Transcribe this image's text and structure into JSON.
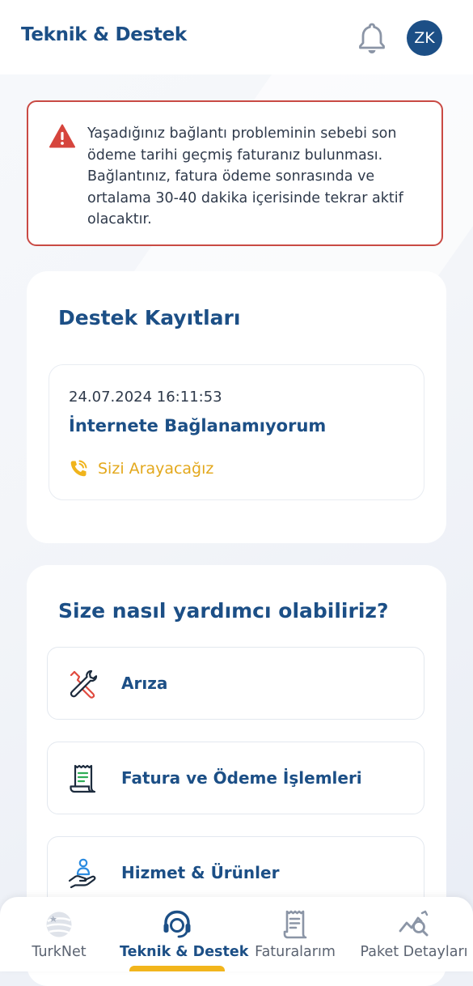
{
  "header": {
    "title": "Teknik & Destek",
    "avatar_initials": "ZK"
  },
  "alert": {
    "message": "Yaşadığınız bağlantı probleminin sebebi son ödeme tarihi geçmiş faturanız bulunması. Bağlantınız, fatura ödeme sonrasında ve ortalama 30-40 dakika içerisinde tekrar aktif olacaktır."
  },
  "records": {
    "title": "Destek Kayıtları",
    "items": [
      {
        "date": "24.07.2024 16:11:53",
        "subject": "İnternete Bağlanamıyorum",
        "status": "Sizi Arayacağız"
      }
    ]
  },
  "help": {
    "title": "Size nasıl yardımcı olabiliriz?",
    "items": [
      {
        "label": "Arıza",
        "icon": "tools-icon"
      },
      {
        "label": "Fatura ve Ödeme İşlemleri",
        "icon": "receipt-icon"
      },
      {
        "label": "Hizmet & Ürünler",
        "icon": "hand-person-icon"
      }
    ]
  },
  "tabbar": {
    "tabs": [
      {
        "label": "TurkNet",
        "icon": "turknet-logo-icon",
        "active": false
      },
      {
        "label": "Teknik & Destek",
        "icon": "headset-icon",
        "active": true
      },
      {
        "label": "Faturalarım",
        "icon": "invoice-icon",
        "active": false
      },
      {
        "label": "Paket Detayları",
        "icon": "chart-search-icon",
        "active": false
      }
    ]
  },
  "colors": {
    "brand": "#1c4f86",
    "alert_border": "#c94a44",
    "accent": "#f2b51c",
    "status": "#e3a81c"
  }
}
